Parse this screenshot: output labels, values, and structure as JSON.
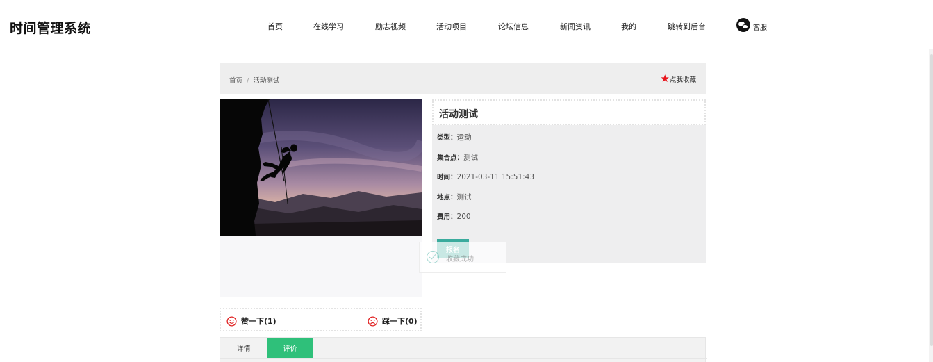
{
  "header": {
    "brand": "时间管理系统",
    "nav": [
      {
        "label": "首页"
      },
      {
        "label": "在线学习"
      },
      {
        "label": "励志视频"
      },
      {
        "label": "活动项目"
      },
      {
        "label": "论坛信息"
      },
      {
        "label": "新闻资讯"
      },
      {
        "label": "我的"
      },
      {
        "label": "跳转到后台"
      }
    ],
    "service": {
      "label": "客服",
      "icon": "wechat-icon"
    }
  },
  "breadcrumb": {
    "home": "首页",
    "separator": "/",
    "current": "活动测试",
    "favorite_label": "点我收藏",
    "favorite_icon": "star-icon",
    "star_color": "#e8141b"
  },
  "activity": {
    "title": "活动测试",
    "fields": [
      {
        "key": "类型：",
        "value": "运动"
      },
      {
        "key": "集合点：",
        "value": "测试"
      },
      {
        "key": "时间：",
        "value": "2021-03-11 15:51:43"
      },
      {
        "key": "地点：",
        "value": "测试"
      },
      {
        "key": "费用：",
        "value": "200"
      }
    ],
    "signup_label": "报名",
    "accent": "#3aab9d"
  },
  "toast": {
    "text": "收藏成功",
    "icon": "check-circle-icon"
  },
  "votes": {
    "like_label": "赞一下(1)",
    "dislike_label": "踩一下(0)",
    "like_icon": "smile-icon",
    "dislike_icon": "frown-icon",
    "icon_color": "#e02020"
  },
  "tabs": [
    {
      "label": "详情",
      "active": false
    },
    {
      "label": "评价",
      "active": true
    }
  ],
  "tab_active_color": "#2fc07a"
}
